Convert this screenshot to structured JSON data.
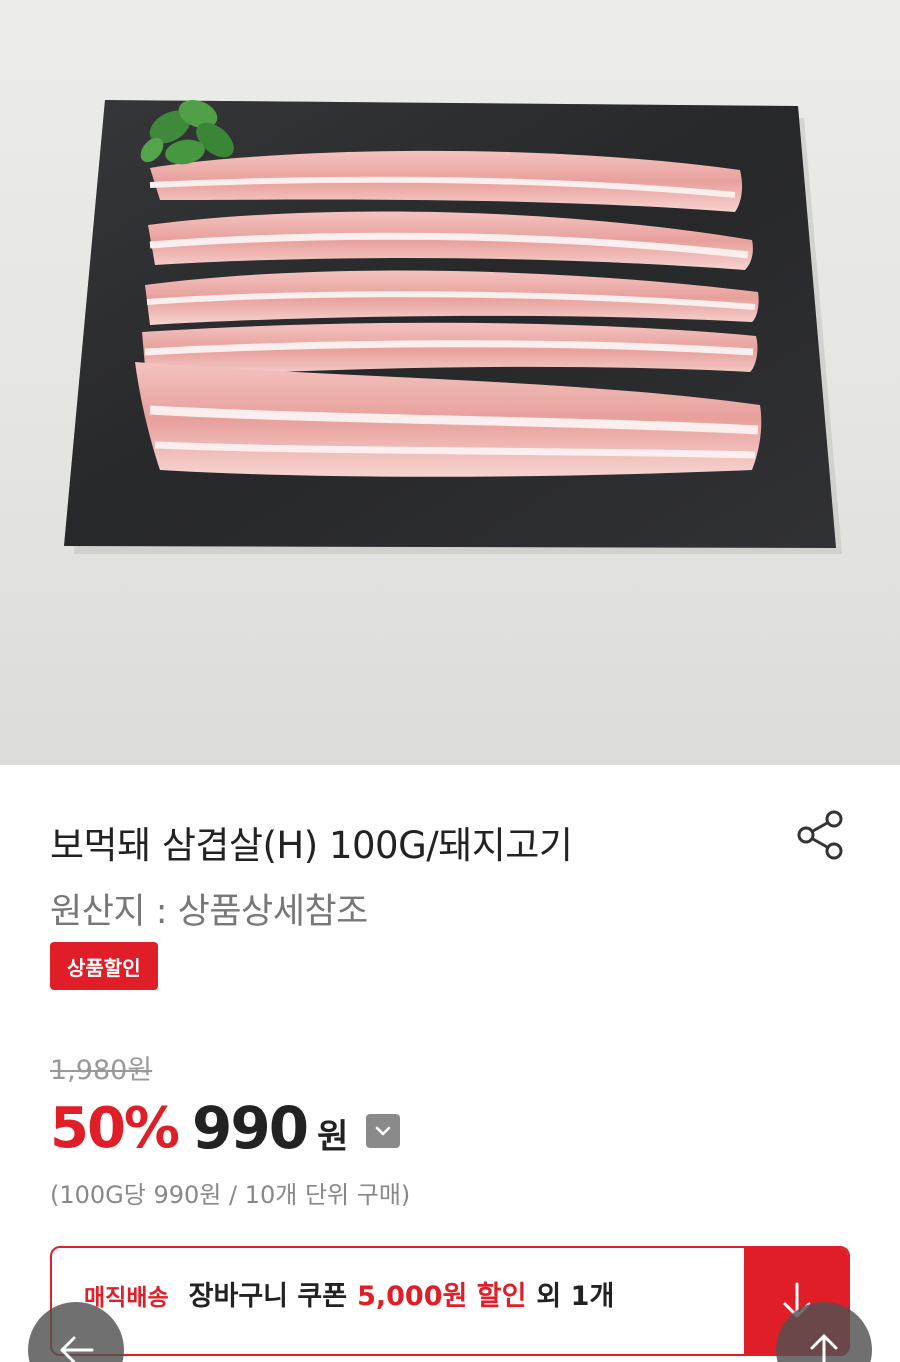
{
  "product": {
    "title": "보먹돼 삼겹살(H) 100G/돼지고기",
    "origin": "원산지 : 상품상세참조",
    "badge": "상품할인",
    "original_price": "1,980원",
    "discount_rate": "50%",
    "sale_price": "990",
    "currency": "원",
    "unit_info": "(100G당 990원 / 10개 단위 구매)"
  },
  "coupon": {
    "tag": "매직배송",
    "main": "장바구니 쿠폰",
    "amount": "5,000원 할인",
    "rest": "외 1개"
  },
  "icons": {
    "share": "share-icon",
    "dropdown": "chevron-down-icon",
    "coupon_download": "arrow-down-icon",
    "back": "arrow-left-icon",
    "top": "arrow-up-icon"
  },
  "colors": {
    "accent": "#e01e28",
    "text": "#222222",
    "muted": "#888888"
  }
}
